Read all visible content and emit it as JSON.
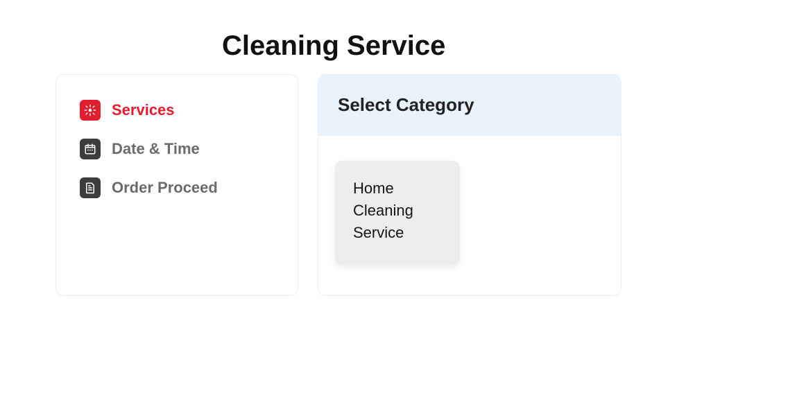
{
  "title": "Cleaning Service",
  "sidebar": {
    "items": [
      {
        "label": "Services",
        "active": true
      },
      {
        "label": "Date & Time",
        "active": false
      },
      {
        "label": "Order Proceed",
        "active": false
      }
    ]
  },
  "panel": {
    "header": "Select Category",
    "categories": [
      {
        "name": "Home Cleaning Service"
      }
    ]
  }
}
